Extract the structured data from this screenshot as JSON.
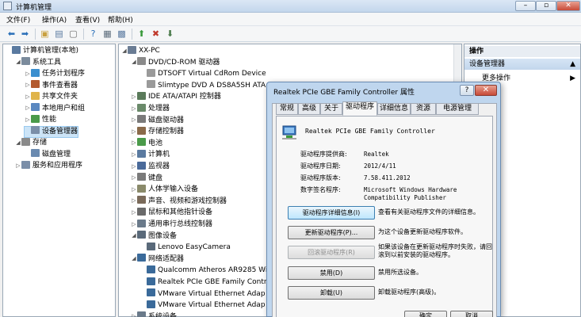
{
  "window": {
    "title": "计算机管理"
  },
  "menu": [
    "文件(F)",
    "操作(A)",
    "查看(V)",
    "帮助(H)"
  ],
  "left_tree": [
    {
      "label": "计算机管理(本地)",
      "indent": 0,
      "exp": "",
      "color": "#5a7aa0"
    },
    {
      "label": "系统工具",
      "indent": 1,
      "exp": "◢",
      "color": "#7b8b9c"
    },
    {
      "label": "任务计划程序",
      "indent": 2,
      "exp": "▷",
      "color": "#3b8fcf"
    },
    {
      "label": "事件查看器",
      "indent": 2,
      "exp": "▷",
      "color": "#b35a2e"
    },
    {
      "label": "共享文件夹",
      "indent": 2,
      "exp": "▷",
      "color": "#e0b44a"
    },
    {
      "label": "本地用户和组",
      "indent": 2,
      "exp": "▷",
      "color": "#5a88c0"
    },
    {
      "label": "性能",
      "indent": 2,
      "exp": "▷",
      "color": "#4a9a4a"
    },
    {
      "label": "设备管理器",
      "indent": 2,
      "exp": "",
      "color": "#7a8ea8"
    },
    {
      "label": "存储",
      "indent": 1,
      "exp": "◢",
      "color": "#8a8a8a"
    },
    {
      "label": "磁盘管理",
      "indent": 2,
      "exp": "",
      "color": "#6a8ab0"
    },
    {
      "label": "服务和应用程序",
      "indent": 1,
      "exp": "▷",
      "color": "#7a8ea8"
    }
  ],
  "device_tree": [
    {
      "label": "XX-PC",
      "indent": 0,
      "exp": "◢",
      "color": "#6a7c94"
    },
    {
      "label": "DVD/CD-ROM 驱动器",
      "indent": 1,
      "exp": "◢",
      "color": "#8a8a8a"
    },
    {
      "label": "DTSOFT Virtual CdRom Device",
      "indent": 2,
      "exp": "",
      "color": "#9a9a9a"
    },
    {
      "label": "Slimtype DVD A  DS8A5SH ATA",
      "indent": 2,
      "exp": "",
      "color": "#9a9a9a"
    },
    {
      "label": "IDE ATA/ATAPI 控制器",
      "indent": 1,
      "exp": "▷",
      "color": "#5a7a5a"
    },
    {
      "label": "处理器",
      "indent": 1,
      "exp": "▷",
      "color": "#6a8a6a"
    },
    {
      "label": "磁盘驱动器",
      "indent": 1,
      "exp": "▷",
      "color": "#7a7a7a"
    },
    {
      "label": "存储控制器",
      "indent": 1,
      "exp": "▷",
      "color": "#8a6a4a"
    },
    {
      "label": "电池",
      "indent": 1,
      "exp": "▷",
      "color": "#4a9a4a"
    },
    {
      "label": "计算机",
      "indent": 1,
      "exp": "▷",
      "color": "#5a7aa0"
    },
    {
      "label": "监视器",
      "indent": 1,
      "exp": "▷",
      "color": "#4a6a9a"
    },
    {
      "label": "键盘",
      "indent": 1,
      "exp": "▷",
      "color": "#7a7a7a"
    },
    {
      "label": "人体学输入设备",
      "indent": 1,
      "exp": "▷",
      "color": "#8a8a6a"
    },
    {
      "label": "声音、视频和游戏控制器",
      "indent": 1,
      "exp": "▷",
      "color": "#7a6a5a"
    },
    {
      "label": "鼠标和其他指针设备",
      "indent": 1,
      "exp": "▷",
      "color": "#6a6a6a"
    },
    {
      "label": "通用串行总线控制器",
      "indent": 1,
      "exp": "▷",
      "color": "#6a7a8a"
    },
    {
      "label": "图像设备",
      "indent": 1,
      "exp": "◢",
      "color": "#5a6a7a"
    },
    {
      "label": "Lenovo EasyCamera",
      "indent": 2,
      "exp": "",
      "color": "#5a6a7a"
    },
    {
      "label": "网络适配器",
      "indent": 1,
      "exp": "◢",
      "color": "#3a6a9a"
    },
    {
      "label": "Qualcomm Atheros AR9285 Wi",
      "indent": 2,
      "exp": "",
      "color": "#3a6a9a"
    },
    {
      "label": "Realtek PCIe GBE Family Contr",
      "indent": 2,
      "exp": "",
      "color": "#3a6a9a"
    },
    {
      "label": "VMware Virtual Ethernet Adap",
      "indent": 2,
      "exp": "",
      "color": "#3a6a9a"
    },
    {
      "label": "VMware Virtual Ethernet Adap",
      "indent": 2,
      "exp": "",
      "color": "#3a6a9a"
    },
    {
      "label": "系统设备",
      "indent": 1,
      "exp": "▷",
      "color": "#6a7a8a"
    }
  ],
  "actions": {
    "header": "操作",
    "section": "设备管理器",
    "more": "更多操作"
  },
  "dialog": {
    "title": "Realtek PCIe GBE Family Controller 属性",
    "help": "?",
    "close": "✕",
    "tabs": [
      "常规",
      "高级",
      "关于",
      "驱动程序",
      "详细信息",
      "资源",
      "电源管理"
    ],
    "device_name": "Realtek PCIe GBE Family Controller",
    "props": [
      {
        "label": "驱动程序提供商:",
        "value": "Realtek"
      },
      {
        "label": "驱动程序日期:",
        "value": "2012/4/11"
      },
      {
        "label": "驱动程序版本:",
        "value": "7.58.411.2012"
      },
      {
        "label": "数字签名程序:",
        "value": "Microsoft Windows Hardware Compatibility Publisher"
      }
    ],
    "buttons": [
      {
        "label": "驱动程序详细信息(I)",
        "desc": "查看有关驱动程序文件的详细信息。",
        "state": "focus"
      },
      {
        "label": "更新驱动程序(P)...",
        "desc": "为这个设备更新驱动程序软件。",
        "state": "normal"
      },
      {
        "label": "回滚驱动程序(R)",
        "desc": "如果该设备在更新驱动程序时失败，请回滚到以前安装的驱动程序。",
        "state": "disabled"
      },
      {
        "label": "禁用(D)",
        "desc": "禁用所选设备。",
        "state": "normal"
      },
      {
        "label": "卸载(U)",
        "desc": "卸载驱动程序(高级)。",
        "state": "normal"
      }
    ],
    "ok": "确定",
    "cancel": "取消"
  }
}
